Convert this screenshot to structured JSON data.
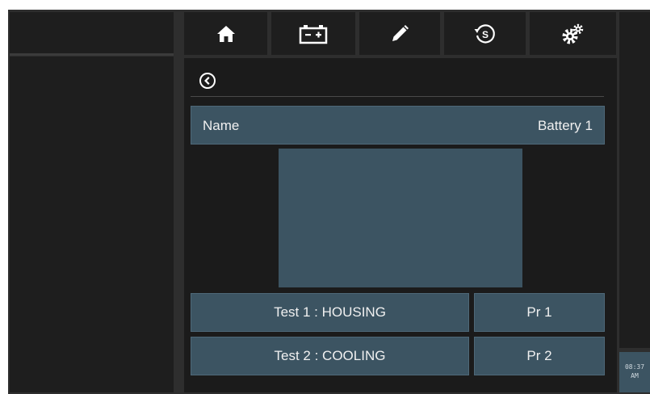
{
  "nav": {
    "tabs": [
      {
        "icon": "home-icon"
      },
      {
        "icon": "battery-icon"
      },
      {
        "icon": "pencil-icon"
      },
      {
        "icon": "schedule-icon"
      },
      {
        "icon": "settings-gears-icon"
      }
    ]
  },
  "panel": {
    "back_icon": "back-circle-icon",
    "name_label": "Name",
    "name_value": "Battery 1"
  },
  "tests": [
    {
      "label": "Test 1 : HOUSING",
      "program": "Pr 1"
    },
    {
      "label": "Test 2 : COOLING",
      "program": "Pr 2"
    }
  ],
  "clock": {
    "time": "08:37",
    "ampm": "AM"
  },
  "colors": {
    "frame": "#2e2e2e",
    "panel_bg": "#1b1b1b",
    "button_bg": "#3c5462",
    "text": "#f0f0f0"
  }
}
